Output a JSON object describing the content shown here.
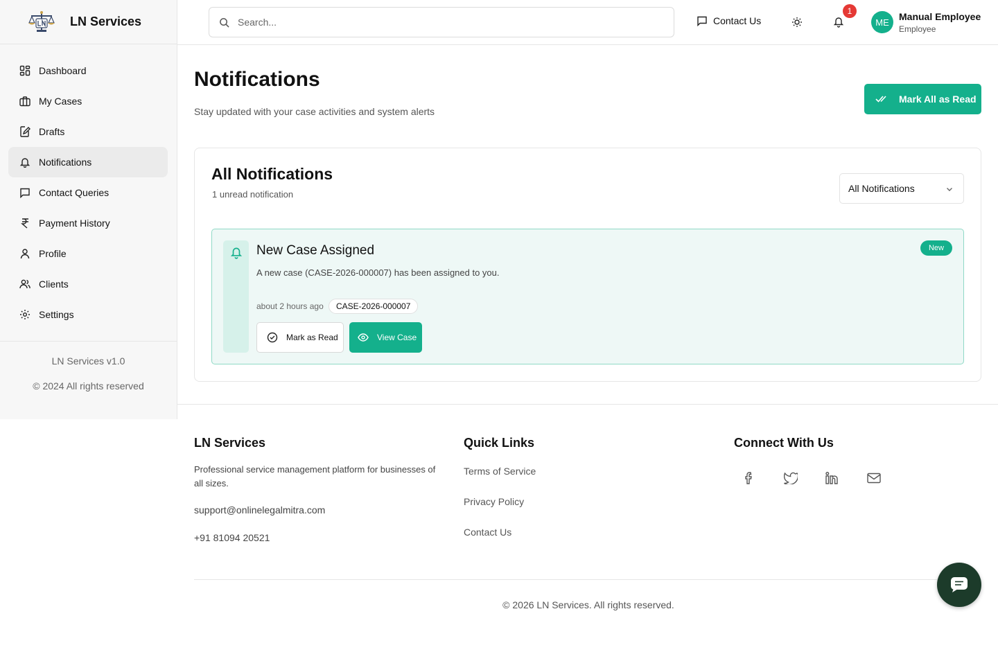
{
  "brand": {
    "name": "LN Services"
  },
  "sidebar": {
    "items": [
      {
        "label": "Dashboard",
        "icon": "dashboard-icon"
      },
      {
        "label": "My Cases",
        "icon": "briefcase-icon"
      },
      {
        "label": "Drafts",
        "icon": "edit-file-icon"
      },
      {
        "label": "Notifications",
        "icon": "bell-icon",
        "active": true
      },
      {
        "label": "Contact Queries",
        "icon": "message-icon"
      },
      {
        "label": "Payment History",
        "icon": "rupee-icon"
      },
      {
        "label": "Profile",
        "icon": "user-icon"
      },
      {
        "label": "Clients",
        "icon": "users-icon"
      },
      {
        "label": "Settings",
        "icon": "gear-icon"
      }
    ],
    "version": "LN Services v1.0",
    "copyright": "© 2024 All rights reserved"
  },
  "header": {
    "search_placeholder": "Search...",
    "contact_label": "Contact Us",
    "notification_count": "1",
    "user": {
      "initials": "ME",
      "name": "Manual Employee",
      "role": "Employee"
    }
  },
  "page": {
    "title": "Notifications",
    "subtitle": "Stay updated with your case activities and system alerts",
    "mark_all_label": "Mark All as Read"
  },
  "card": {
    "title": "All Notifications",
    "unread_text": "1 unread notification",
    "filter_value": "All Notifications",
    "notification": {
      "title": "New Case Assigned",
      "message": "A new case (CASE-2026-000007) has been assigned to you.",
      "time": "about 2 hours ago",
      "case_id": "CASE-2026-000007",
      "badge": "New",
      "mark_read_label": "Mark as Read",
      "view_label": "View Case"
    }
  },
  "footer": {
    "col1": {
      "title": "LN Services",
      "description": "Professional service management platform for businesses of all sizes.",
      "email": "support@onlinelegalmitra.com",
      "phone": "+91 81094 20521"
    },
    "col2": {
      "title": "Quick Links",
      "links": [
        "Terms of Service",
        "Privacy Policy",
        "Contact Us"
      ]
    },
    "col3": {
      "title": "Connect With Us",
      "socials": [
        "facebook-icon",
        "twitter-icon",
        "linkedin-icon",
        "mail-icon"
      ]
    },
    "copyright": "© 2026 LN Services. All rights reserved."
  },
  "colors": {
    "accent": "#14b08c",
    "badge": "#e53935",
    "chat_fab": "#1c3b2a"
  }
}
